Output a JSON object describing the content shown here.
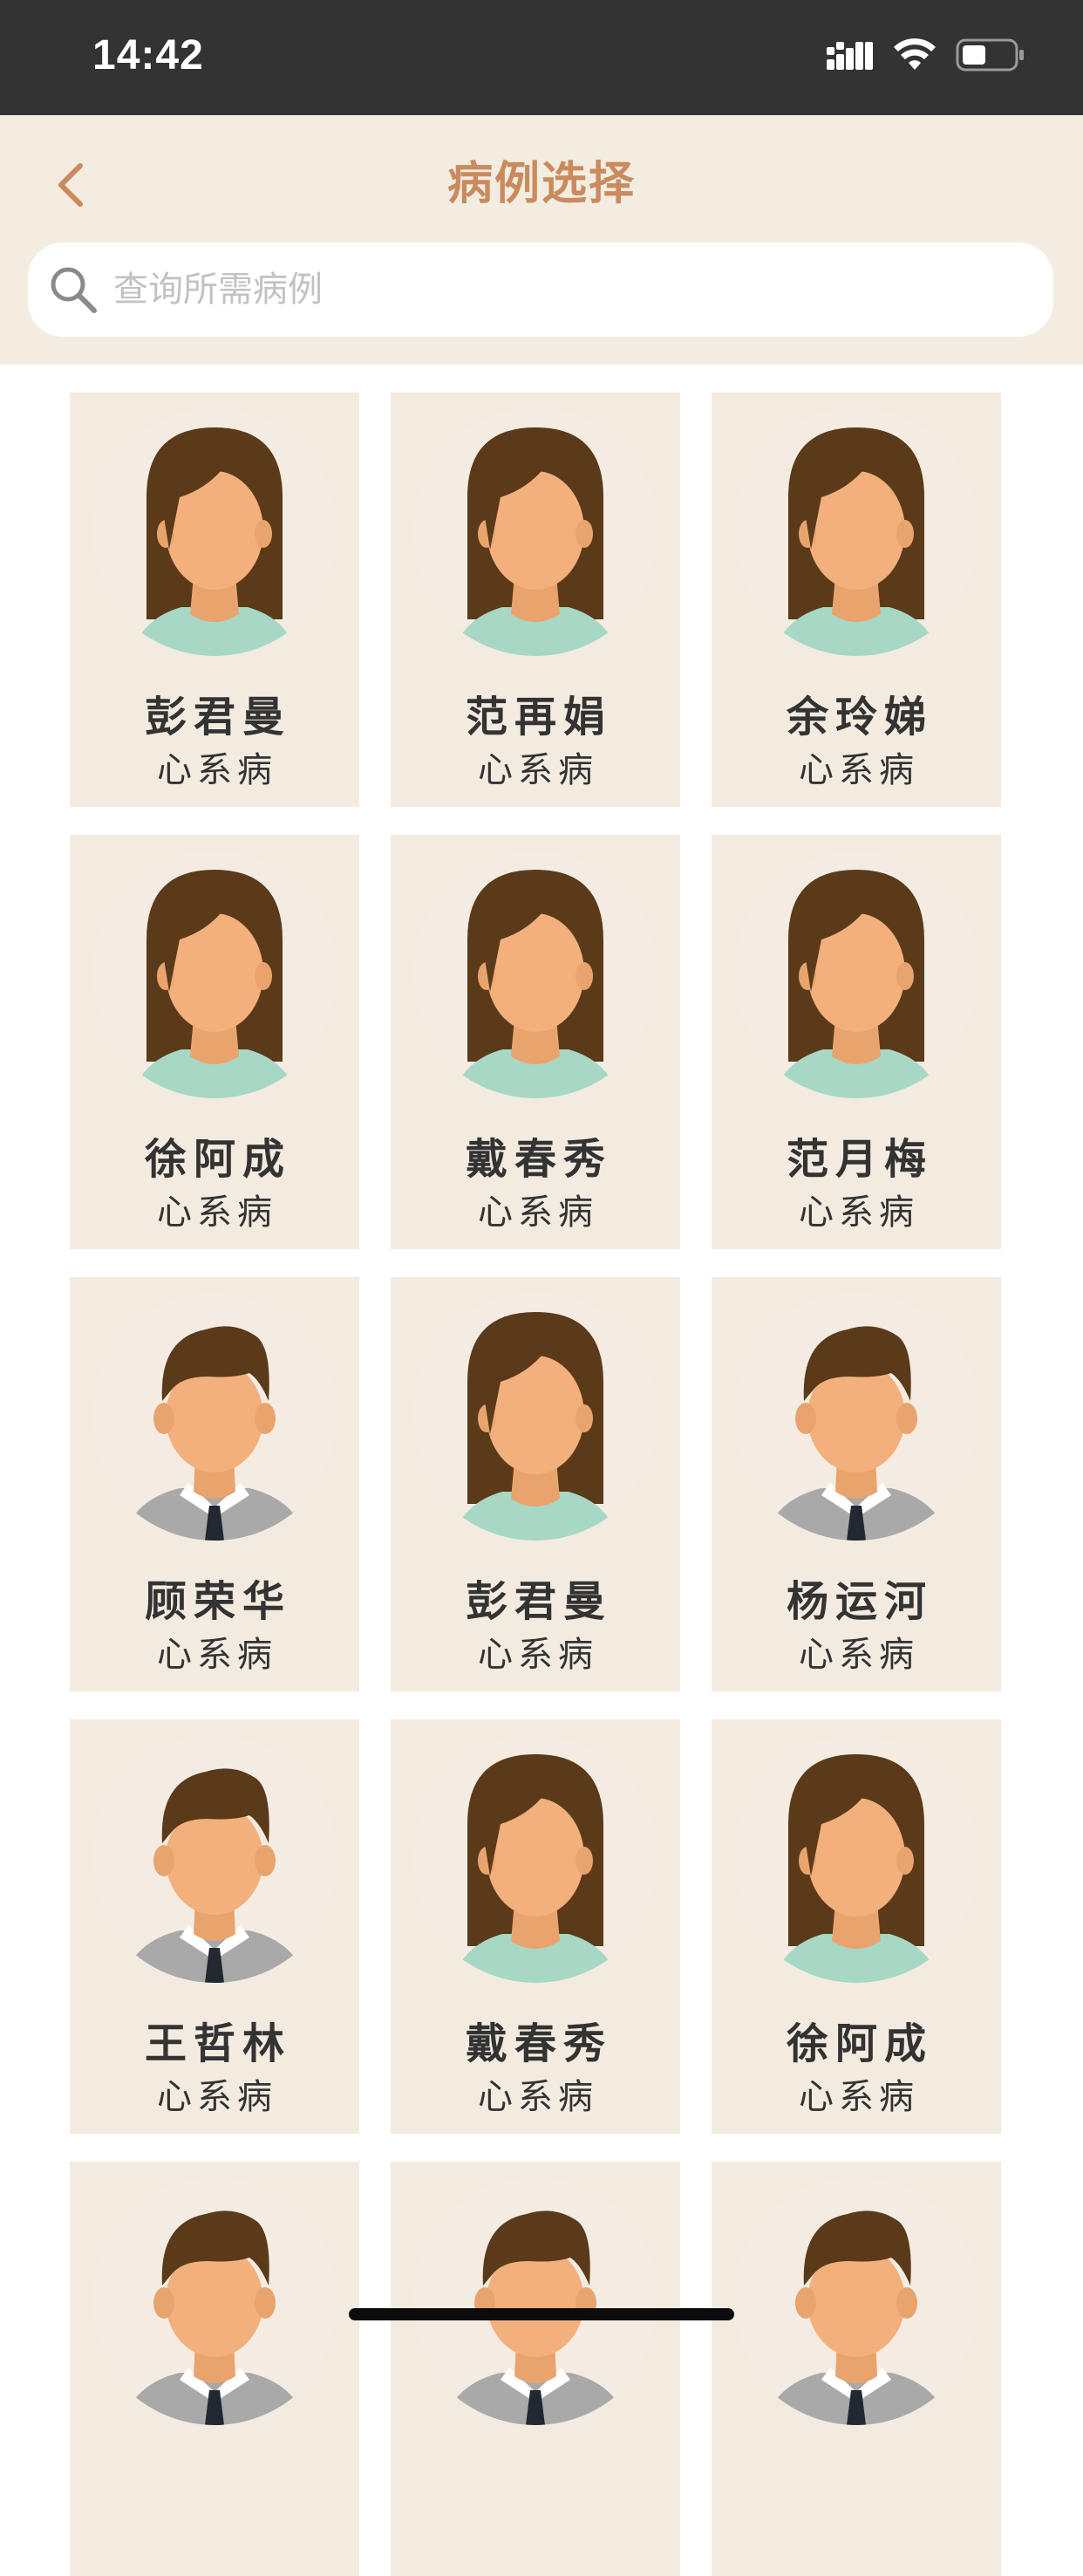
{
  "status_bar": {
    "time": "14:42"
  },
  "header": {
    "title": "病例选择",
    "accent_color": "#c98b5e"
  },
  "search": {
    "placeholder": "查询所需病例",
    "value": ""
  },
  "cases": [
    {
      "name": "彭君曼",
      "type": "心系病",
      "gender": "female"
    },
    {
      "name": "范再娟",
      "type": "心系病",
      "gender": "female"
    },
    {
      "name": "余玲娣",
      "type": "心系病",
      "gender": "female"
    },
    {
      "name": "徐阿成",
      "type": "心系病",
      "gender": "female"
    },
    {
      "name": "戴春秀",
      "type": "心系病",
      "gender": "female"
    },
    {
      "name": "范月梅",
      "type": "心系病",
      "gender": "female"
    },
    {
      "name": "顾荣华",
      "type": "心系病",
      "gender": "male"
    },
    {
      "name": "彭君曼",
      "type": "心系病",
      "gender": "female"
    },
    {
      "name": "杨运河",
      "type": "心系病",
      "gender": "male"
    },
    {
      "name": "王哲林",
      "type": "心系病",
      "gender": "male"
    },
    {
      "name": "戴春秀",
      "type": "心系病",
      "gender": "female"
    },
    {
      "name": "徐阿成",
      "type": "心系病",
      "gender": "female"
    },
    {
      "name": "",
      "type": "",
      "gender": "male"
    },
    {
      "name": "",
      "type": "",
      "gender": "male"
    },
    {
      "name": "",
      "type": "",
      "gender": "male"
    }
  ]
}
